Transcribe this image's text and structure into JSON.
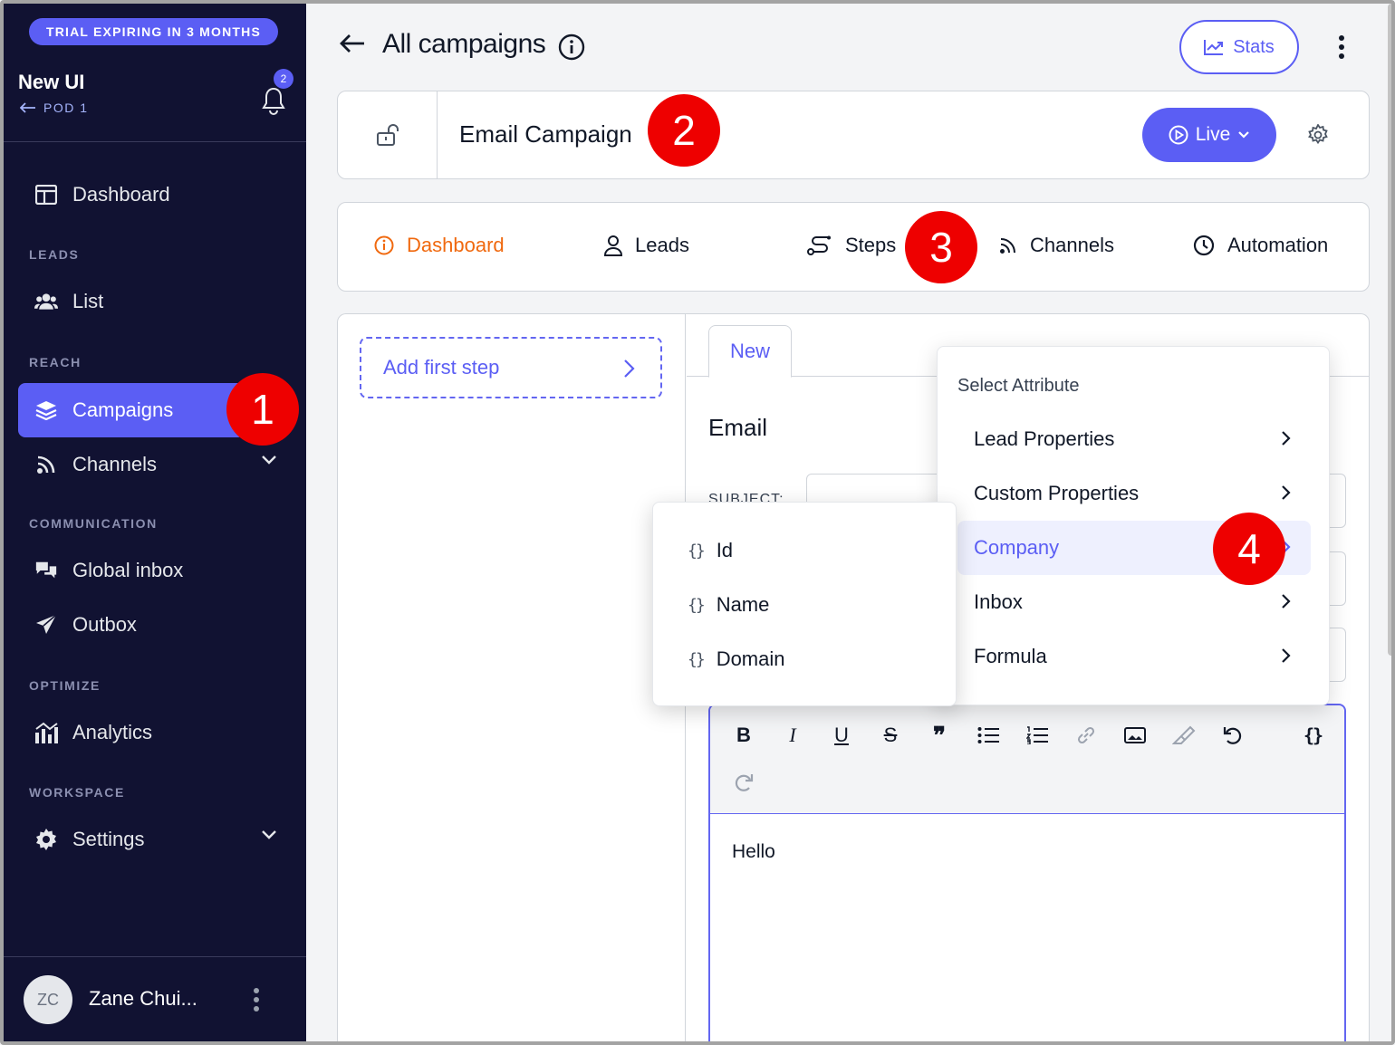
{
  "trial_badge": "TRIAL EXPIRING IN 3 MONTHS",
  "workspace": {
    "name": "New UI",
    "pod": "POD 1",
    "notifications": "2"
  },
  "sidebar": {
    "dashboard": "Dashboard",
    "sections": {
      "leads": "LEADS",
      "reach": "REACH",
      "communication": "COMMUNICATION",
      "optimize": "OPTIMIZE",
      "workspace": "WORKSPACE"
    },
    "list": "List",
    "campaigns": "Campaigns",
    "channels": "Channels",
    "global_inbox": "Global inbox",
    "outbox": "Outbox",
    "analytics": "Analytics",
    "settings": "Settings"
  },
  "user": {
    "initials": "ZC",
    "name": "Zane Chui..."
  },
  "header": {
    "title": "All campaigns",
    "stats_label": "Stats"
  },
  "campaign": {
    "name": "Email Campaign",
    "status_label": "Live"
  },
  "tabs": {
    "dashboard": "Dashboard",
    "leads": "Leads",
    "steps": "Steps",
    "channels": "Channels",
    "automation": "Automation"
  },
  "steps": {
    "add_first": "Add first step"
  },
  "editor": {
    "tab_new": "New",
    "section_title": "Email",
    "subject_label": "SUBJECT:",
    "body_text": "Hello"
  },
  "attribute_menu": {
    "title": "Select Attribute",
    "items": [
      "Lead Properties",
      "Custom Properties",
      "Company",
      "Inbox",
      "Formula"
    ]
  },
  "company_submenu": {
    "items": [
      "Id",
      "Name",
      "Domain"
    ]
  },
  "markers": [
    "1",
    "2",
    "3",
    "4"
  ],
  "colors": {
    "accent": "#5b5ef4",
    "sidebar_bg": "#111232",
    "active_tab": "#f0690f",
    "marker": "#ee0000"
  }
}
